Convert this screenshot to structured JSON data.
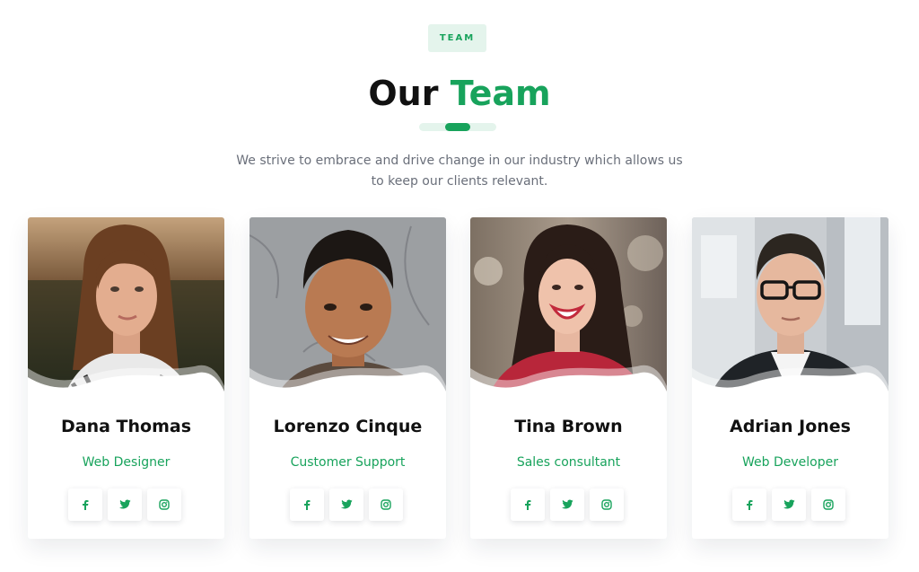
{
  "header": {
    "badge": "TEAM",
    "title_prefix": "Our",
    "title_accent": "Team",
    "intro_line1": "We strive to embrace and drive change in our industry which allows us",
    "intro_line2": "to keep our clients relevant."
  },
  "colors": {
    "accent": "#18a35c",
    "accent_light": "#e4f4ec",
    "heading": "#111111",
    "body_text": "#6a6f7a"
  },
  "social_icons": [
    "facebook-icon",
    "twitter-icon",
    "instagram-icon"
  ],
  "team": [
    {
      "name": "Dana Thomas",
      "role": "Web Designer"
    },
    {
      "name": "Lorenzo Cinque",
      "role": "Customer Support"
    },
    {
      "name": "Tina Brown",
      "role": "Sales consultant"
    },
    {
      "name": "Adrian Jones",
      "role": "Web Developer"
    }
  ]
}
